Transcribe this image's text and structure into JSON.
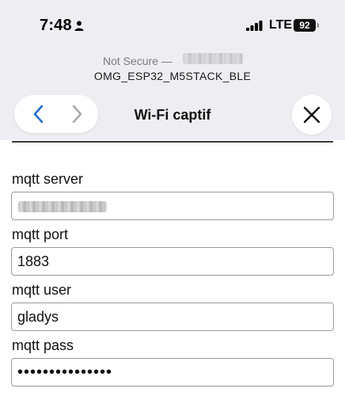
{
  "status_bar": {
    "time": "7:48",
    "network": "LTE",
    "battery": "92"
  },
  "browser": {
    "security_label": "Not Secure —",
    "site_name": "OMG_ESP32_M5STACK_BLE",
    "page_title": "Wi-Fi captif"
  },
  "form": {
    "fields": [
      {
        "label": "mqtt server",
        "value": ""
      },
      {
        "label": "mqtt port",
        "value": "1883"
      },
      {
        "label": "mqtt user",
        "value": "gladys"
      },
      {
        "label": "mqtt pass",
        "value": "•••••••••••••••"
      }
    ]
  },
  "colors": {
    "chrome_bg": "#eeeef2",
    "back_chevron": "#1f6fd1",
    "forward_chevron_disabled": "#a9a9b0"
  }
}
